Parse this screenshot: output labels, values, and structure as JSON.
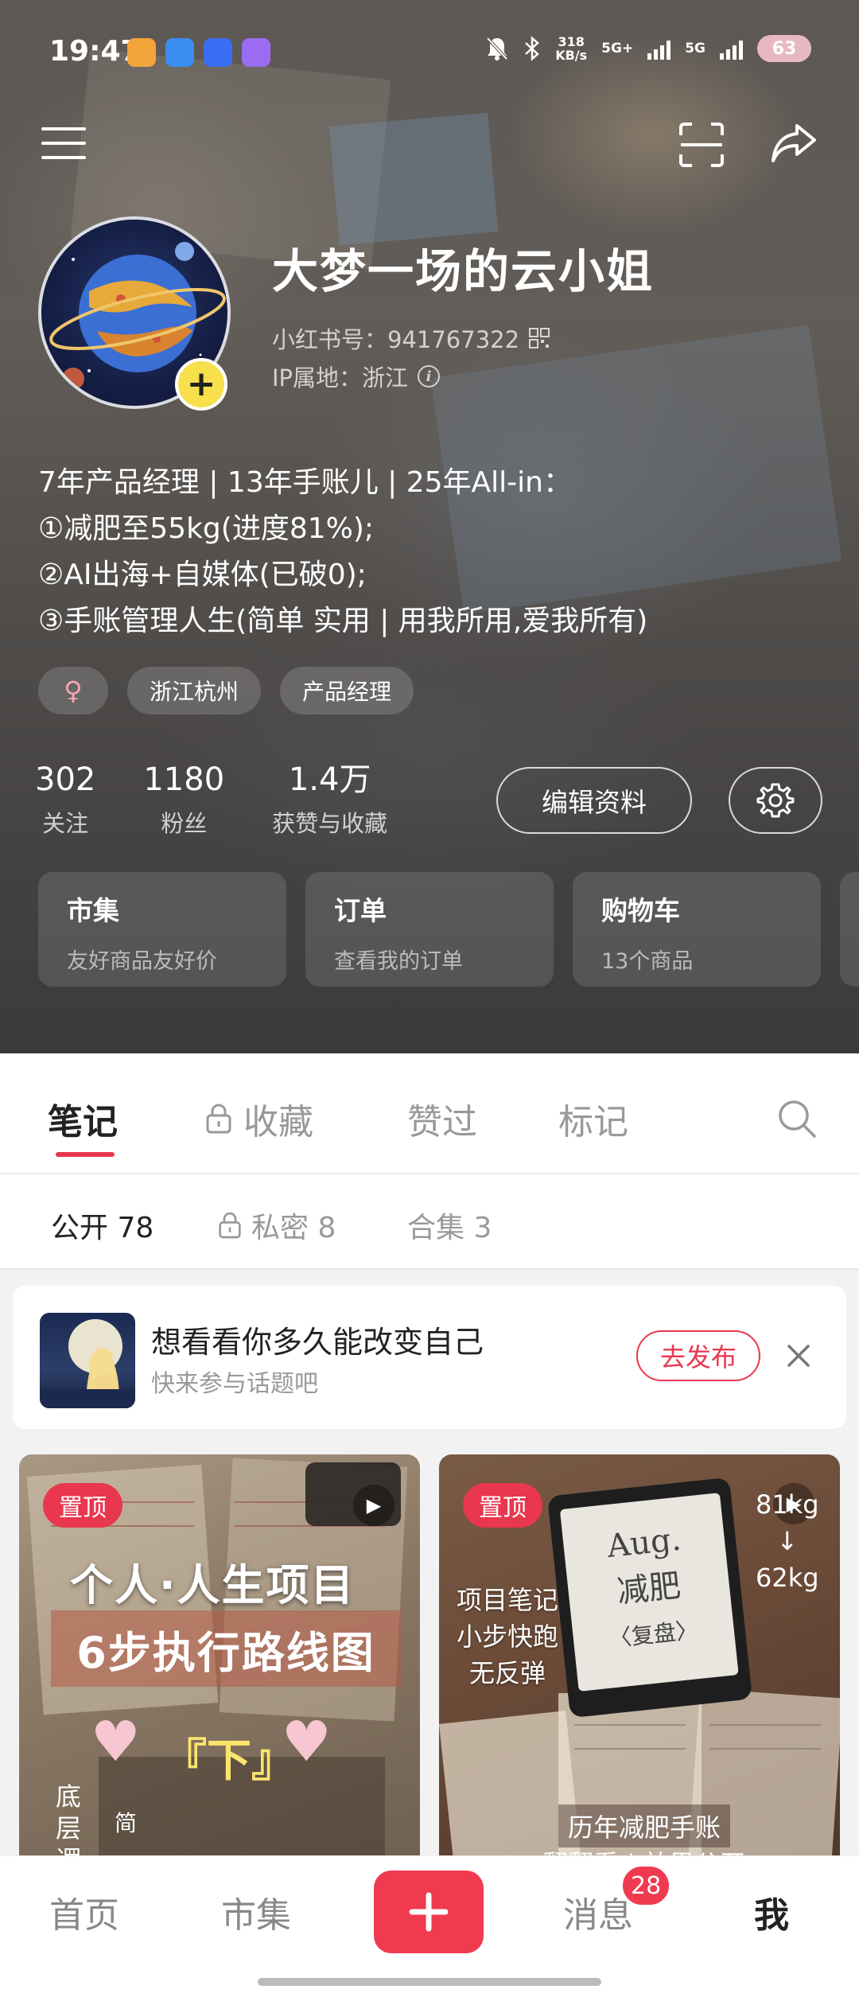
{
  "status_bar": {
    "time": "19:47",
    "speed_value": "318",
    "speed_unit": "KB/s",
    "network_1": "5G+",
    "network_2": "5G",
    "battery": "63"
  },
  "profile": {
    "name": "大梦一场的云小姐",
    "id_text": "小红书号：941767322",
    "ip_text": "IP属地：浙江",
    "bio_lines": [
      "7年产品经理 | 13年手账儿 | 25年All-in：",
      "①减肥至55kg(进度81%);",
      "②AI出海+自媒体(已破0);",
      "③手账管理人生(简单 实用 | 用我所用,爱我所有)"
    ],
    "gender_symbol": "♀",
    "tags": [
      "浙江杭州",
      "产品经理"
    ]
  },
  "stats": [
    {
      "num": "302",
      "label": "关注"
    },
    {
      "num": "1180",
      "label": "粉丝"
    },
    {
      "num": "1.4万",
      "label": "获赞与收藏"
    }
  ],
  "buttons": {
    "edit_profile": "编辑资料"
  },
  "cards": [
    {
      "title": "市集",
      "sub": "友好商品友好价"
    },
    {
      "title": "订单",
      "sub": "查看我的订单"
    },
    {
      "title": "购物车",
      "sub": "13个商品"
    }
  ],
  "tabs": [
    "笔记",
    "收藏",
    "赞过",
    "标记"
  ],
  "subtabs": [
    "公开 78",
    "私密 8",
    "合集 3"
  ],
  "promo": {
    "title": "想看看你多久能改变自己",
    "sub": "快来参与话题吧",
    "button": "去发布"
  },
  "notes": [
    {
      "pin": "置顶",
      "line1": "个人·人生项目",
      "line2": "6步执行路线图",
      "down": "『下』",
      "side_text": "底层逻",
      "side_text2": "简"
    },
    {
      "pin": "置顶",
      "weight_top": "81kg",
      "arrow": "↓",
      "weight_bottom": "62kg",
      "tablet_l1": "Aug.",
      "tablet_l2": "减肥",
      "tablet_l3": "〈复盘〉",
      "left_lines": [
        "项目笔记",
        "小步快跑",
        "无反弹"
      ],
      "bottom_line1": "历年减肥手账",
      "bottom_line2": "翻翻看 | 效果公开"
    }
  ],
  "bottom_nav": {
    "items": [
      "首页",
      "市集",
      "消息",
      "我"
    ],
    "badge": "28"
  },
  "colors": {
    "accent": "#e8374e",
    "avatar_add": "#f7e04b"
  }
}
